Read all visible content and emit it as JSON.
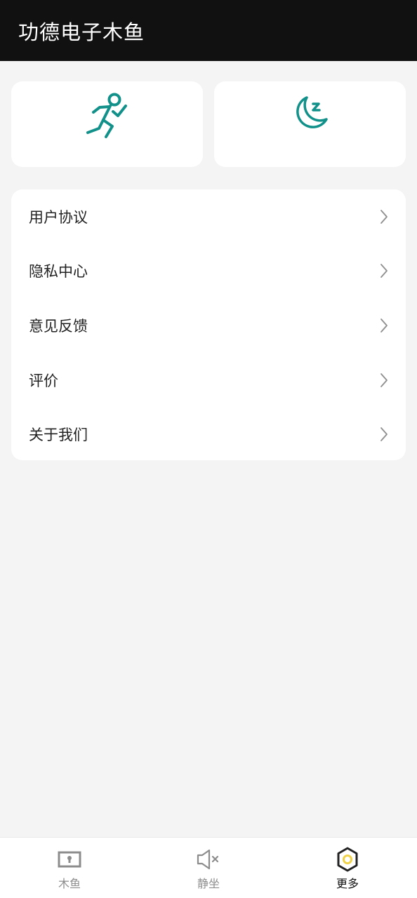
{
  "header": {
    "title": "功德电子木鱼"
  },
  "cards": [
    {
      "icon": "running-person-icon",
      "color": "#12918a"
    },
    {
      "icon": "sleep-moon-icon",
      "color": "#12918a"
    }
  ],
  "menu": {
    "items": [
      {
        "label": "用户协议"
      },
      {
        "label": "隐私中心"
      },
      {
        "label": "意见反馈"
      },
      {
        "label": "评价"
      },
      {
        "label": "关于我们"
      }
    ]
  },
  "tabbar": {
    "tabs": [
      {
        "label": "木鱼",
        "icon": "wooden-fish-icon",
        "active": false
      },
      {
        "label": "静坐",
        "icon": "speaker-mute-icon",
        "active": false
      },
      {
        "label": "更多",
        "icon": "hexagon-more-icon",
        "active": true
      }
    ]
  },
  "colors": {
    "accent": "#12918a",
    "header_bg": "#111111",
    "active_tab_ring": "#f0d24a"
  }
}
